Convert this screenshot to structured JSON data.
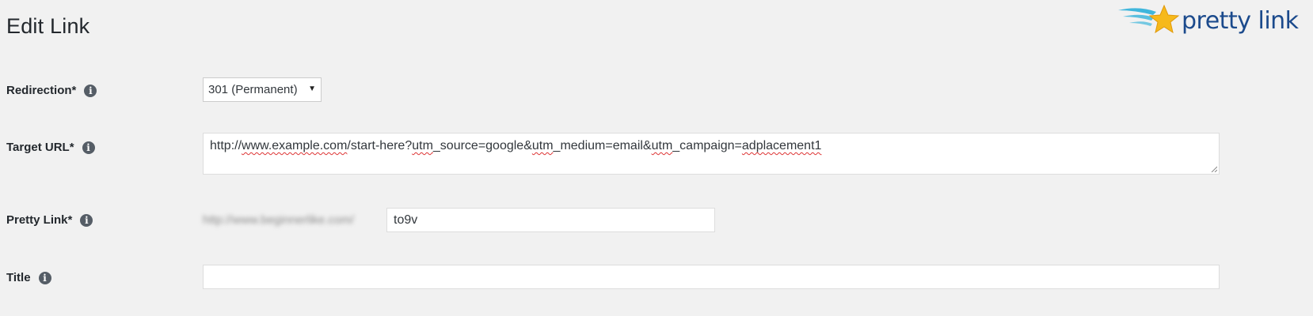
{
  "page": {
    "title": "Edit Link"
  },
  "logo": {
    "text": "pretty link",
    "icon": "star-wings-logo-icon",
    "color": "#1b4a8c",
    "star_color": "#f6b91b",
    "wing_color": "#3fb6dc"
  },
  "form": {
    "redirection": {
      "label": "Redirection*",
      "selected": "301 (Permanent)"
    },
    "target_url": {
      "label": "Target URL*",
      "value_parts": [
        {
          "text": "http",
          "spell": false
        },
        {
          "text": "://",
          "spell": false
        },
        {
          "text": "www.example.com",
          "spell": true
        },
        {
          "text": "/start-here?",
          "spell": false
        },
        {
          "text": "utm",
          "spell": true
        },
        {
          "text": "_source=google&",
          "spell": false
        },
        {
          "text": "utm",
          "spell": true
        },
        {
          "text": "_medium=email&",
          "spell": false
        },
        {
          "text": "utm",
          "spell": true
        },
        {
          "text": "_campaign=",
          "spell": false
        },
        {
          "text": "adplacement1",
          "spell": true
        }
      ]
    },
    "pretty_link": {
      "label": "Pretty Link*",
      "base_url": "http://www.beginnerlike.com/",
      "slug": "to9v"
    },
    "title": {
      "label": "Title",
      "value": ""
    }
  },
  "colors": {
    "background": "#f1f1f1",
    "info_icon": "#555d66",
    "spellcheck": "#dd3333"
  }
}
